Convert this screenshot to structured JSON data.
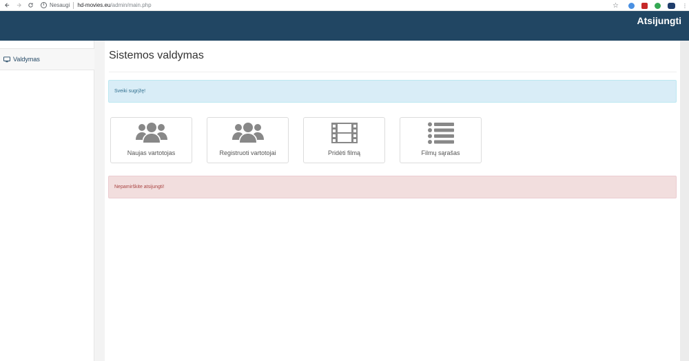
{
  "browser": {
    "security_label": "Nesaugi",
    "url_host": "hd-movies.eu",
    "url_path": "/admin/main.php"
  },
  "navbar": {
    "logout_label": "Atsijungti",
    "bg_color": "#214663"
  },
  "sidebar": {
    "items": [
      {
        "label": "Valdymas",
        "icon": "monitor-icon"
      }
    ]
  },
  "main": {
    "title": "Sistemos valdymas",
    "welcome_alert": "Sveiki sugrįžę!",
    "logout_reminder_alert": "Nepamirškite atsijungti!",
    "tiles": [
      {
        "label": "Naujas vartotojas",
        "icon": "users-icon"
      },
      {
        "label": "Registruoti vartotojai",
        "icon": "users-icon"
      },
      {
        "label": "Pridėti filmą",
        "icon": "film-icon"
      },
      {
        "label": "Filmų sąrašas",
        "icon": "list-icon"
      }
    ]
  }
}
